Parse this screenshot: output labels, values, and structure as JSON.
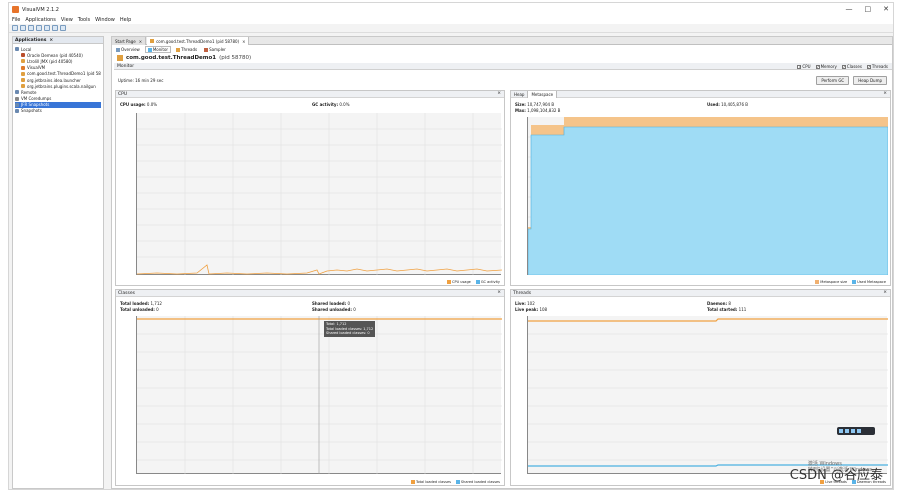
{
  "window": {
    "title": "VisualVM 2.1.2",
    "controls": [
      "—",
      "□",
      "✕"
    ]
  },
  "menu": [
    "File",
    "Applications",
    "View",
    "Tools",
    "Window",
    "Help"
  ],
  "left_panel": {
    "header": "Applications",
    "items": [
      {
        "label": "Local",
        "color": "#6a89b0",
        "indent": 0
      },
      {
        "label": "Oracle Demean (pid 40540)",
        "color": "#b94d2a",
        "indent": 2
      },
      {
        "label": "Ltrolill JMX (pid 40580)",
        "color": "#e0a040",
        "indent": 2
      },
      {
        "label": "VisualVM",
        "color": "#e07a2b",
        "indent": 2
      },
      {
        "label": "com.good.test.ThreadDemo1 (pid 5878",
        "color": "#e0a040",
        "indent": 2
      },
      {
        "label": "org.jetbrains.idea.launcher",
        "color": "#e0a040",
        "indent": 2
      },
      {
        "label": "org.jetbrains.plugins.scala.nailgun",
        "color": "#e0a040",
        "indent": 2
      },
      {
        "label": "Remote",
        "color": "#6a89b0",
        "indent": 0
      },
      {
        "label": "VM Coredumps",
        "color": "#888888",
        "indent": 0
      },
      {
        "label": "JFR Snapshots",
        "color": "#6a89b0",
        "indent": 0,
        "selected": true
      },
      {
        "label": "Snapshots",
        "color": "#6a89b0",
        "indent": 0
      }
    ]
  },
  "doc_tabs": [
    "Start Page",
    "com.good.test.ThreadDemo1 (pid 58780)"
  ],
  "sub_tabs": [
    "Overview",
    "Monitor",
    "Threads",
    "Sampler"
  ],
  "app": {
    "name": "com.good.test.ThreadDemo1",
    "pid": "(pid 58780)"
  },
  "monitor": {
    "header": "Monitor",
    "checks": [
      "CPU",
      "Memory",
      "Classes",
      "Threads"
    ],
    "uptime": "Uptime: 16 min 29 sec",
    "buttons": [
      "Perform GC",
      "Heap Dump"
    ]
  },
  "cpu": {
    "title": "CPU",
    "stats": [
      {
        "label": "CPU usage:",
        "value": "0.0%"
      },
      {
        "label": "GC activity:",
        "value": "0.0%"
      }
    ],
    "legend": [
      {
        "name": "CPU usage",
        "color": "#f0a040"
      },
      {
        "name": "GC activity",
        "color": "#5ab4e8"
      }
    ]
  },
  "heap": {
    "tabs": [
      "Heap",
      "Metaspace"
    ],
    "stats": [
      {
        "label": "Size:",
        "value": "10,747,904 B"
      },
      {
        "label": "Used:",
        "value": "10,405,876 B"
      },
      {
        "label": "Max:",
        "value": "1,098,104,832 B"
      }
    ],
    "legend": [
      {
        "name": "Metaspace size",
        "color": "#f0b070"
      },
      {
        "name": "Used Metaspace",
        "color": "#5ab4e8"
      }
    ]
  },
  "classes": {
    "title": "Classes",
    "stats": [
      {
        "label": "Total loaded:",
        "value": "1,712"
      },
      {
        "label": "Shared loaded:",
        "value": "0"
      },
      {
        "label": "Total unloaded:",
        "value": "0"
      },
      {
        "label": "Shared unloaded:",
        "value": "0"
      }
    ],
    "tooltip": [
      "Total: 1,712",
      "Total loaded classes: 1,712",
      "Shared loaded classes: 0"
    ],
    "legend": [
      {
        "name": "Total loaded classes",
        "color": "#f0a040"
      },
      {
        "name": "Shared loaded classes",
        "color": "#5ab4e8"
      }
    ]
  },
  "threads": {
    "title": "Threads",
    "stats": [
      {
        "label": "Live:",
        "value": "102"
      },
      {
        "label": "Daemon:",
        "value": "8"
      },
      {
        "label": "Live peak:",
        "value": "108"
      },
      {
        "label": "Total started:",
        "value": "111"
      }
    ],
    "legend": [
      {
        "name": "Live threads",
        "color": "#f0a040"
      },
      {
        "name": "Daemon threads",
        "color": "#5ab4e8"
      }
    ]
  },
  "watermark": {
    "text": "CSDN @谷应泰",
    "activate": [
      "激活 Windows",
      "转到“设置”以激活 Windows。"
    ]
  }
}
